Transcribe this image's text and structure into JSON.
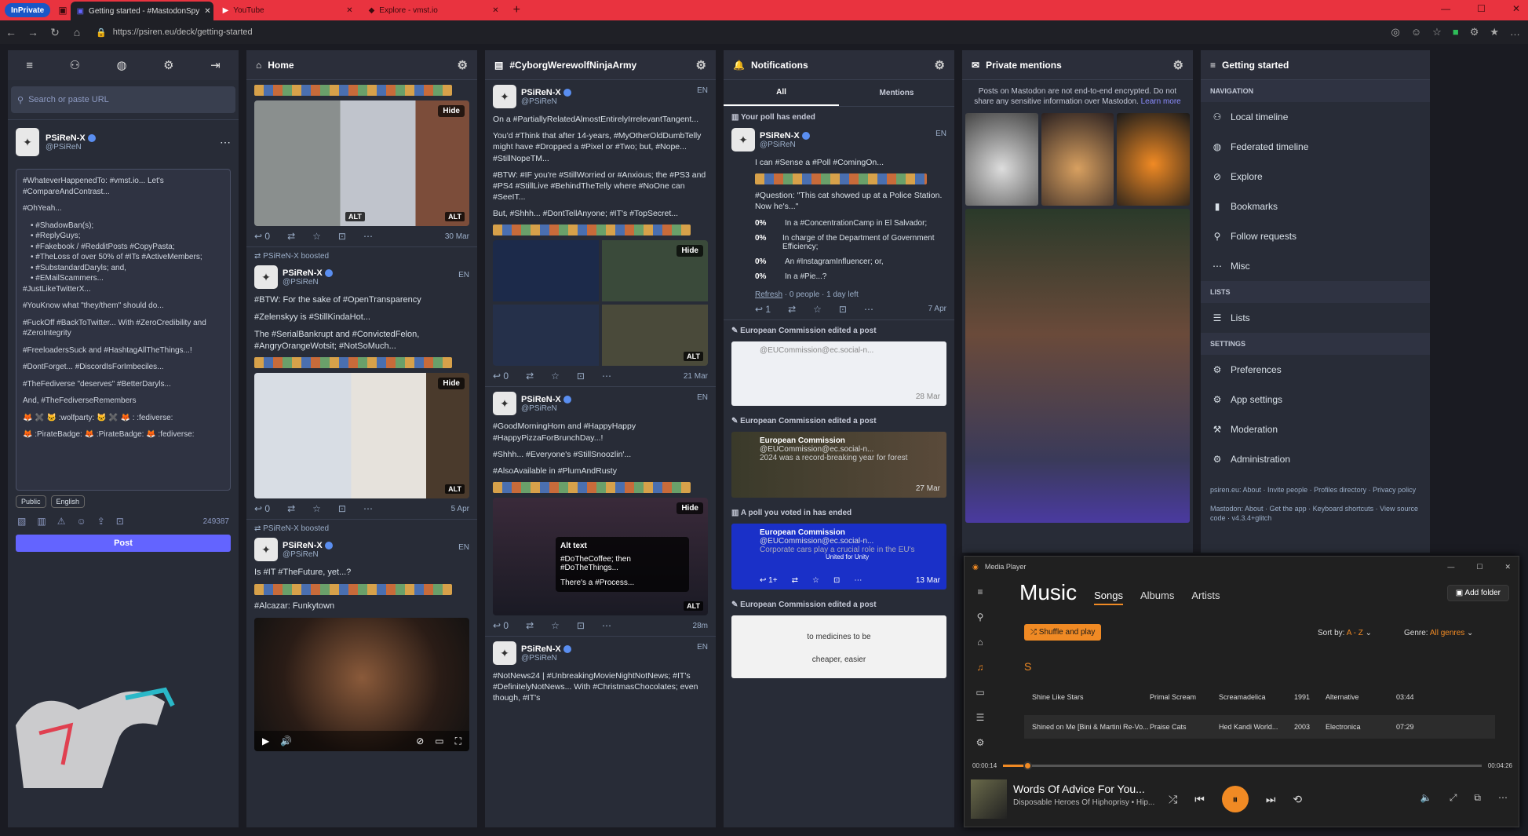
{
  "browser": {
    "inprivate": "InPrivate",
    "tabs": [
      {
        "title": "Getting started - #MastodonSpy"
      },
      {
        "title": "YouTube"
      },
      {
        "title": "Explore - vmst.io"
      }
    ],
    "url": "https://psiren.eu/deck/getting-started"
  },
  "compose": {
    "search_placeholder": "Search or paste URL",
    "user_name": "PSiReN-X",
    "user_handle": "@PSiReN",
    "text_lines": [
      "#WhateverHappenedTo: #vmst.io... Let's #CompareAndContrast...",
      "#OhYeah...",
      "• #ShadowBan(s);",
      "• #ReplyGuys;",
      "• #Fakebook / #RedditPosts #CopyPasta;",
      "• #TheLoss of over 50% of #ITs #ActiveMembers;",
      "• #SubstandardDaryls; and,",
      "• #EMailScammers...",
      "#JustLikeTwitterX...",
      "#YouKnow what \"they/them\" should do...",
      "#FuckOff #BackToTwitter... With #ZeroCredibility and #ZeroIntegrity",
      "#FreeloadersSuck and #HashtagAllTheThings...!",
      "#DontForget... #DiscordIsForImbeciles...",
      "#TheFediverse \"deserves\" #BetterDaryls...",
      "And, #TheFediverseRemembers",
      "🦊 ✖️ 🐱 :wolfparty: 🐱 ✖️ 🦊 : :fediverse:",
      "🦊 :PirateBadge: 🦊 :PirateBadge: 🦊 :fediverse:"
    ],
    "visibility": "Public",
    "language": "English",
    "char_count": "249387",
    "post_label": "Post"
  },
  "home": {
    "title": "Home",
    "posts": [
      {
        "date": "30 Mar",
        "hide": "Hide",
        "alt": "ALT",
        "replies": "0"
      },
      {
        "boost": "PSiReN-X boosted",
        "name": "PSiReN-X",
        "handle": "@PSiReN",
        "lang": "EN",
        "lines": [
          "#BTW: For the sake of #OpenTransparency",
          "#Zelenskyy is #StillKindaHot...",
          "The #SerialBankrupt and #ConvictedFelon, #AngryOrangeWotsit; #NotSoMuch..."
        ],
        "hide": "Hide",
        "alt": "ALT",
        "date": "5 Apr",
        "replies": "0"
      },
      {
        "boost": "PSiReN-X boosted",
        "name": "PSiReN-X",
        "handle": "@PSiReN",
        "lang": "EN",
        "lines": [
          "Is #IT #TheFuture, yet...?"
        ],
        "extra": "#Alcazar: Funkytown"
      }
    ]
  },
  "hashtag": {
    "title": "#CyborgWerewolfNinjaArmy",
    "posts": [
      {
        "name": "PSiReN-X",
        "handle": "@PSiReN",
        "lang": "EN",
        "lines": [
          "On a #PartiallyRelatedAlmostEntirelyIrrelevantTangent...",
          "You'd #Think that after 14-years, #MyOtherOldDumbTelly might have #Dropped a #Pixel or #Two; but, #Nope... #StillNopeTM...",
          "#BTW: #IF you're #StillWorried or #Anxious; the #PS3 and #PS4 #StillLive #BehindTheTelly where #NoOne can #SeeIT...",
          "But, #Shhh... #DontTellAnyone; #IT's #TopSecret..."
        ],
        "hide": "Hide",
        "alt": "ALT",
        "date": "21 Mar",
        "replies": "0"
      },
      {
        "name": "PSiReN-X",
        "handle": "@PSiReN",
        "lang": "EN",
        "lines": [
          "#GoodMorningHorn and #HappyHappy #HappyPizzaForBrunchDay...!",
          "#Shhh... #Everyone's #StillSnoozlin'...",
          "#AlsoAvailable in #PlumAndRusty"
        ],
        "hide": "Hide",
        "alt": "ALT",
        "alttext_title": "Alt text",
        "alttext_lines": [
          "#DoTheCoffee; then #DoTheThings...",
          "There's a #Process..."
        ],
        "date": "28m",
        "replies": "0"
      },
      {
        "name": "PSiReN-X",
        "handle": "@PSiReN",
        "lang": "EN",
        "lines": [
          "#NotNews24 | #UnbreakingMovieNightNotNews; #IT's #DefinitelyNotNews... With #ChristmasChocolates; even though, #IT's"
        ]
      }
    ]
  },
  "notifications": {
    "title": "Notifications",
    "tab_all": "All",
    "tab_mentions": "Mentions",
    "poll_ended": "Your poll has ended",
    "poll_post": {
      "name": "PSiReN-X",
      "handle": "@PSiReN",
      "lang": "EN",
      "text": "I can #Sense a #Poll #ComingOn...",
      "question": "#Question: \"This cat showed up at a Police Station. Now he's...\"",
      "options": [
        {
          "pct": "0%",
          "label": "In a #ConcentrationCamp in El Salvador;"
        },
        {
          "pct": "0%",
          "label": "In charge of the Department of Government Efficiency;"
        },
        {
          "pct": "0%",
          "label": "An #InstagramInfluencer; or,"
        },
        {
          "pct": "0%",
          "label": "In a #Pie...?"
        }
      ],
      "footer_refresh": "Refresh",
      "footer_rest": " · 0 people · 1 day left",
      "date": "7 Apr",
      "replies": "1"
    },
    "edited_1": "European Commission edited a post",
    "edit1_handle": "@EUCommission@ec.social-n...",
    "edit1_date": "28 Mar",
    "edited_2": "European Commission edited a post",
    "edit2_name": "European Commission",
    "edit2_handle": "@EUCommission@ec.social-n...",
    "edit2_text": "2024 was a record-breaking year for forest",
    "edit2_date": "27 Mar",
    "poll_voted": "A poll you voted in has ended",
    "poll2_name": "European Commission",
    "poll2_handle": "@EUCommission@ec.social-n...",
    "poll2_text": "Corporate cars play a crucial role in the EU's",
    "poll2_badge": "United for Unity",
    "poll2_date": "13 Mar",
    "poll2_replies": "1+",
    "edited_3": "European Commission edited a post",
    "edit3_text1": "to medicines to be",
    "edit3_text2": "cheaper, easier"
  },
  "mentions": {
    "title": "Private mentions",
    "warning": "Posts on Mastodon are not end-to-end encrypted. Do not share any sensitive information over Mastodon.",
    "learn_more": "Learn more"
  },
  "getting_started": {
    "title": "Getting started",
    "sections": [
      {
        "label": "NAVIGATION",
        "items": [
          "Local timeline",
          "Federated timeline",
          "Explore",
          "Bookmarks",
          "Follow requests",
          "Misc"
        ]
      },
      {
        "label": "LISTS",
        "items": [
          "Lists"
        ]
      },
      {
        "label": "SETTINGS",
        "items": [
          "Preferences",
          "App settings",
          "Moderation",
          "Administration"
        ]
      }
    ],
    "footer1": "psiren.eu: About · Invite people · Profiles directory · Privacy policy",
    "footer2": "Mastodon: About · Get the app · Keyboard shortcuts · View source code · v4.3.4+glitch"
  },
  "media_player": {
    "app_title": "Media Player",
    "heading": "Music",
    "tabs": [
      "Songs",
      "Albums",
      "Artists"
    ],
    "add_folder": "Add folder",
    "shuffle": "Shuffle and play",
    "sort_label": "Sort by:",
    "sort_value": "A - Z",
    "genre_label": "Genre:",
    "genre_value": "All genres",
    "letter": "S",
    "rows": [
      {
        "title": "Shine Like Stars",
        "artist": "Primal Scream",
        "album": "Screamadelica",
        "year": "1991",
        "genre": "Alternative",
        "dur": "03:44"
      },
      {
        "title": "Shined on Me [Bini & Martini Re-Vo...",
        "artist": "Praise Cats",
        "album": "Hed Kandi World...",
        "year": "2003",
        "genre": "Electronica",
        "dur": "07:29"
      }
    ],
    "elapsed": "00:00:14",
    "total": "00:04:26",
    "progress": 0.05,
    "now_title": "Words Of Advice For You...",
    "now_artist": "Disposable Heroes Of Hiphoprisy • Hip..."
  },
  "colors": {
    "accent": "#6364ff",
    "tabbar": "#e9333f",
    "column_bg": "#282c37",
    "mp_accent": "#f08a24"
  }
}
